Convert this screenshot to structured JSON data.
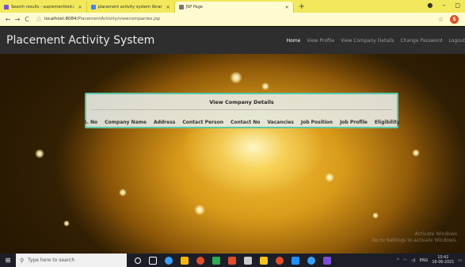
{
  "browser": {
    "tabs": [
      {
        "label": "Search results - supremenfood.i",
        "favicon_color": "#7a4ed6",
        "active": false
      },
      {
        "label": "placement activity system librar",
        "favicon_color": "#4285f4",
        "active": false
      },
      {
        "label": "JSP Page",
        "favicon_color": "#777777",
        "active": true
      }
    ],
    "new_tab": "+",
    "window_controls": {
      "record": "●",
      "minimize": "–",
      "maximize": "◻"
    },
    "nav": {
      "back": "←",
      "forward": "→",
      "reload": "C"
    },
    "address": {
      "host": "localhost:8084",
      "path": "/PlacementActivity/viewcompanies.jsp"
    },
    "star": "☆",
    "profile_initial": "S"
  },
  "site": {
    "brand": "Placement Activity System",
    "nav_items": [
      "Home",
      "View Profile",
      "View Company Details",
      "Change Password",
      "Logout"
    ]
  },
  "panel": {
    "title": "View Company Details",
    "columns": [
      "S. No",
      "Company Name",
      "Address",
      "Contact Person",
      "Contact No",
      "Vacancies",
      "Job Position",
      "Job Profile",
      "Eligibility"
    ]
  },
  "watermark": {
    "line1": "Activate Windows",
    "line2": "Go to Settings to activate Windows."
  },
  "taskbar": {
    "search_placeholder": "Type here to search",
    "time": "10:42",
    "date": "16-06-2021",
    "lang": "ENG",
    "app_icon_colors": [
      "#ffffff",
      "#ffffff",
      "#3aa0ff",
      "#f5b800",
      "#e24c2a",
      "#2eaa55",
      "#e24c2a",
      "#cccccc",
      "#f5c518",
      "#e24c2a",
      "#1f8fff",
      "#3aa0ff",
      "#7a4ed6"
    ]
  }
}
